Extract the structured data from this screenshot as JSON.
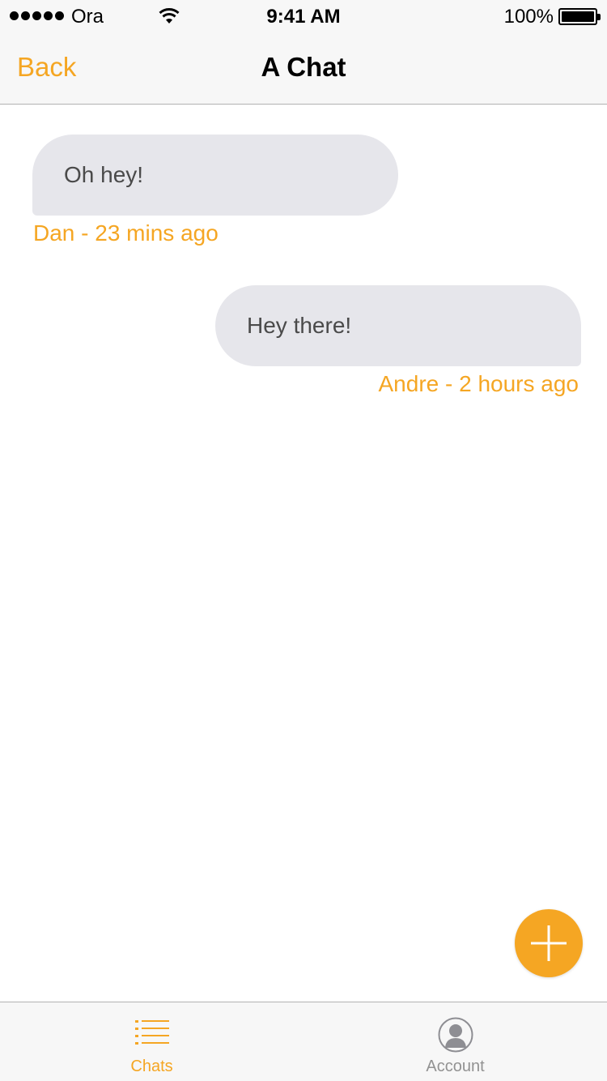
{
  "status_bar": {
    "carrier": "Ora",
    "time": "9:41 AM",
    "battery": "100%"
  },
  "nav": {
    "back_label": "Back",
    "title": "A Chat"
  },
  "messages": [
    {
      "text": "Oh hey!",
      "meta": "Dan - 23 mins ago",
      "align": "left"
    },
    {
      "text": "Hey there!",
      "meta": "Andre - 2 hours ago",
      "align": "right"
    }
  ],
  "fab": {
    "icon": "plus-icon"
  },
  "tabs": [
    {
      "label": "Chats",
      "icon": "list-icon",
      "active": true
    },
    {
      "label": "Account",
      "icon": "user-icon",
      "active": false
    }
  ],
  "colors": {
    "accent": "#f5a623",
    "bubble": "#e6e6eb",
    "inactive_tab": "#929292"
  }
}
